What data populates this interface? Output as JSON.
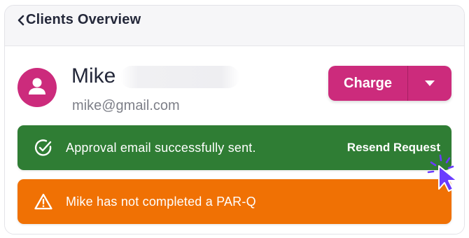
{
  "header": {
    "title": "Clients Overview",
    "back_icon": "chevron-left-icon"
  },
  "client": {
    "name": "Mike",
    "email": "mike@gmail.com",
    "avatar_icon": "person-icon",
    "avatar_color": "#cc2b7c"
  },
  "actions": {
    "charge_label": "Charge",
    "dropdown_icon": "caret-down-icon",
    "brand_color": "#cc2b7c"
  },
  "alerts": {
    "success": {
      "message": "Approval email successfully sent.",
      "action_label": "Resend Request",
      "icon": "check-circle-icon",
      "color": "#2f7d34"
    },
    "warning": {
      "message": "Mike has not completed a PAR-Q",
      "icon": "warning-triangle-icon",
      "color": "#f07104"
    }
  }
}
